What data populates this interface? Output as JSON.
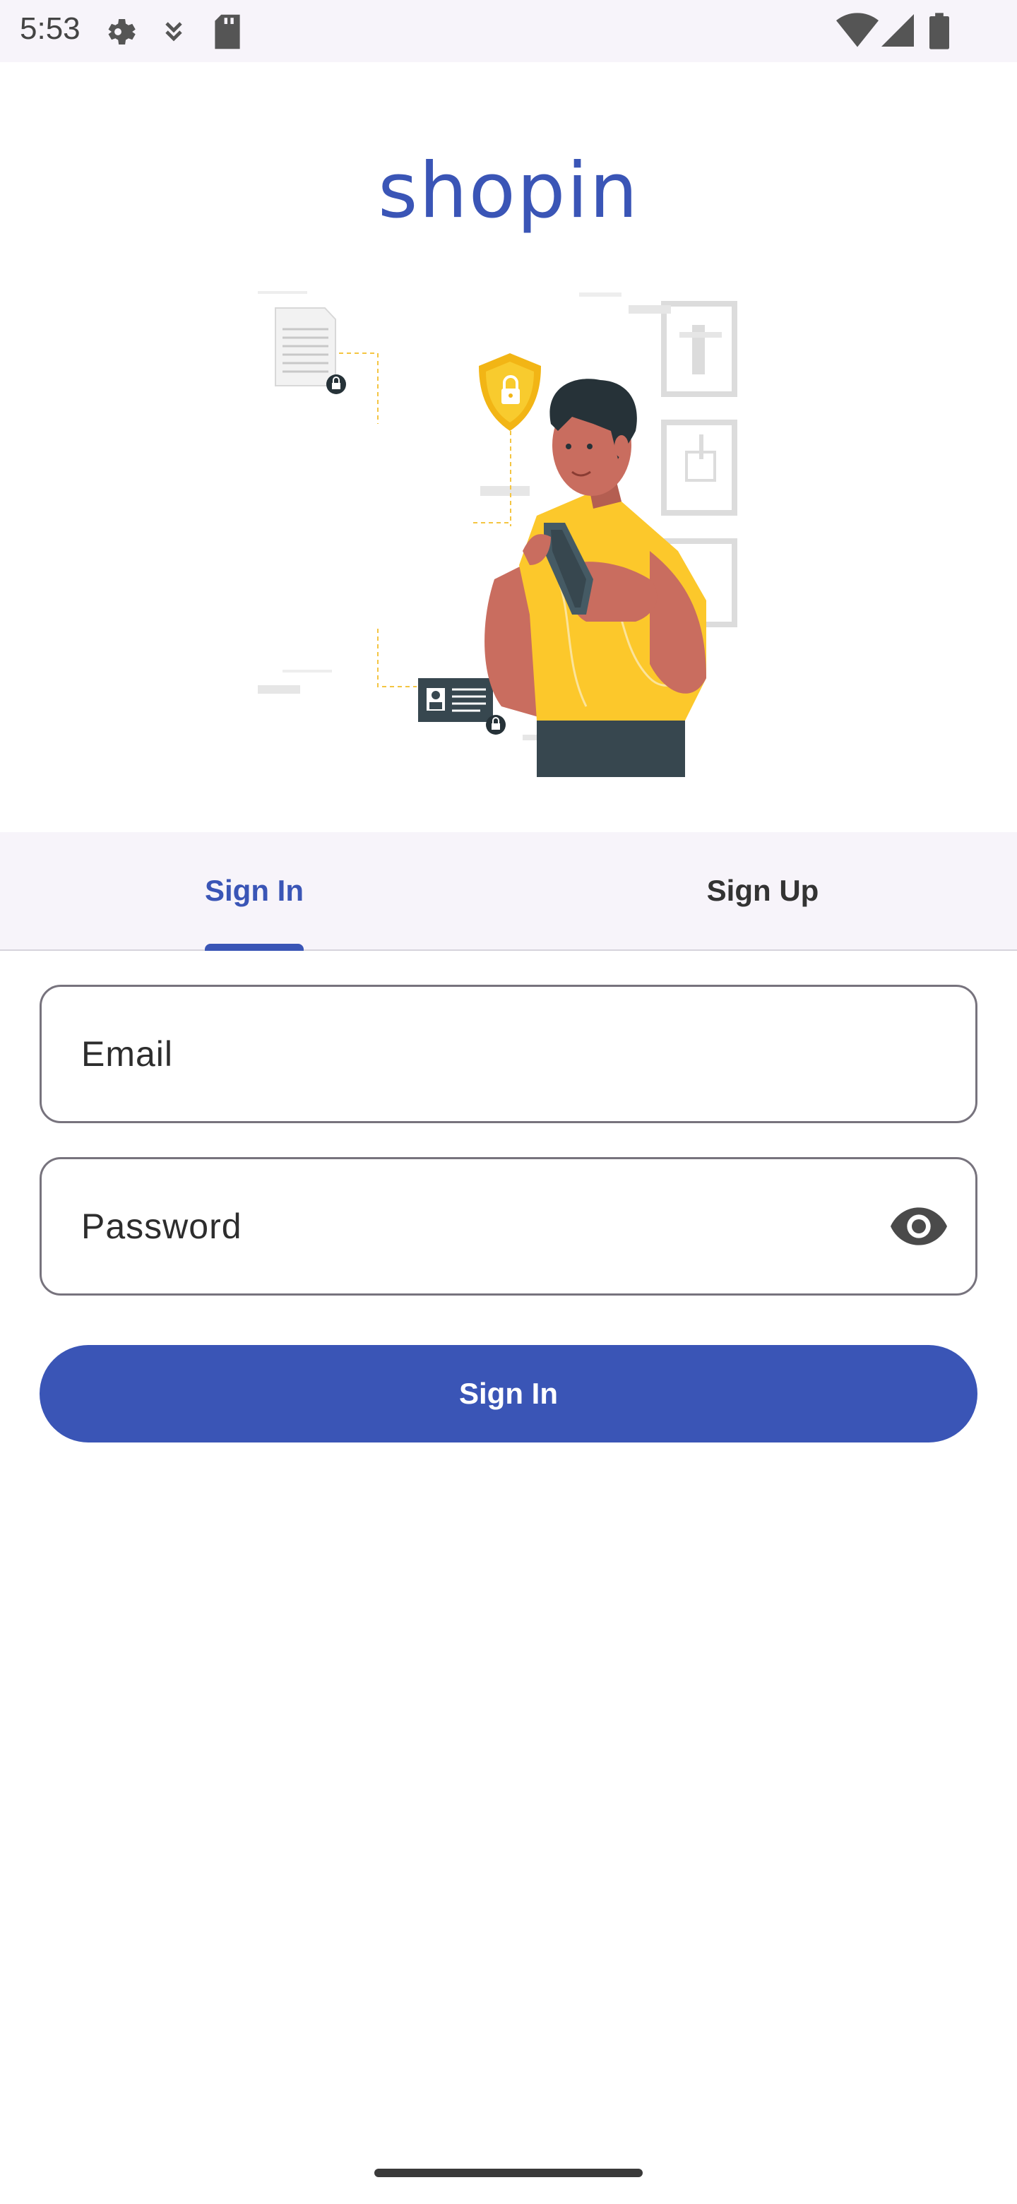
{
  "status_bar": {
    "time": "5:53",
    "icons": [
      "settings-icon",
      "download-icon",
      "sd-card-icon",
      "wifi-icon",
      "signal-icon",
      "battery-icon"
    ]
  },
  "app": {
    "logo_text": "shopin",
    "brand_color": "#3a55b6"
  },
  "tabs": [
    {
      "label": "Sign In",
      "selected": true
    },
    {
      "label": "Sign Up",
      "selected": false
    }
  ],
  "form": {
    "email_label": "Email",
    "password_label": "Password",
    "password_toggle_icon": "eye-icon",
    "submit_label": "Sign In"
  },
  "illustration": {
    "name": "security-login-illustration"
  }
}
